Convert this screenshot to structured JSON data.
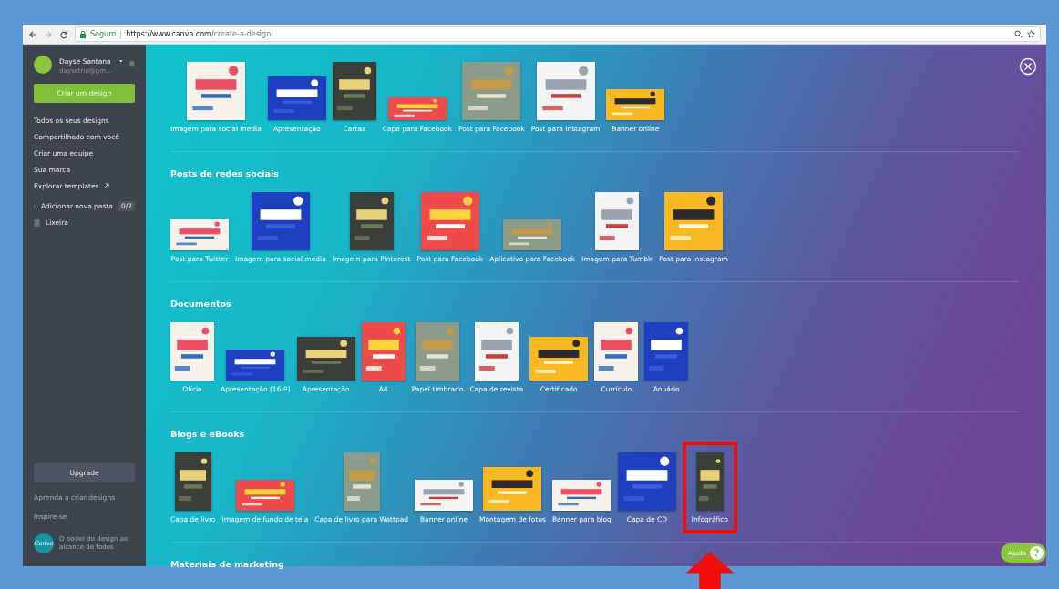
{
  "browser": {
    "security_label": "Seguro",
    "url_host": "https://www.canva.com",
    "url_path": "/create-a-design"
  },
  "sidebar": {
    "user": {
      "name": "Dayse Santana",
      "email": "daysetrin@gm..."
    },
    "create_button": "Criar um design",
    "nav": [
      {
        "label": "Todos os seus designs",
        "external": false
      },
      {
        "label": "Compartilhado com você",
        "external": false
      },
      {
        "label": "Criar uma equipe",
        "external": false
      },
      {
        "label": "Sua marca",
        "external": false
      },
      {
        "label": "Explorar templates",
        "external": true
      }
    ],
    "folder": {
      "label": "Adicionar nova pasta",
      "count": "0/2"
    },
    "trash": "Lixeira",
    "upgrade": "Upgrade",
    "links": [
      "Aprenda a criar designs",
      "Inspire-se"
    ],
    "logo": "Canva",
    "tagline": "O poder do design ao alcance de todos"
  },
  "sections": [
    {
      "items": [
        {
          "label": "Imagem para social media",
          "kind": "square",
          "highlighted": false
        },
        {
          "label": "Apresentação",
          "kind": "landscape",
          "highlighted": false
        },
        {
          "label": "Cartaz",
          "kind": "portrait",
          "highlighted": false
        },
        {
          "label": "Capa para Facebook",
          "kind": "banner",
          "highlighted": false
        },
        {
          "label": "Post para Facebook",
          "kind": "square",
          "highlighted": false
        },
        {
          "label": "Post para Instagram",
          "kind": "square",
          "highlighted": false
        },
        {
          "label": "Banner online",
          "kind": "wide",
          "highlighted": false
        }
      ]
    },
    {
      "title": "Posts de redes sociais",
      "items": [
        {
          "label": "Post para Twitter",
          "kind": "wide",
          "highlighted": false
        },
        {
          "label": "Imagem para social media",
          "kind": "square",
          "highlighted": false
        },
        {
          "label": "Imagem para Pinterest",
          "kind": "portrait",
          "highlighted": false
        },
        {
          "label": "Post para Facebook",
          "kind": "square",
          "highlighted": false
        },
        {
          "label": "Aplicativo para Facebook",
          "kind": "wide",
          "highlighted": false
        },
        {
          "label": "Imagem para Tumblr",
          "kind": "portrait",
          "highlighted": false
        },
        {
          "label": "Post para Instagram",
          "kind": "square",
          "highlighted": false
        }
      ]
    },
    {
      "title": "Documentos",
      "items": [
        {
          "label": "Ofício",
          "kind": "portrait",
          "highlighted": false
        },
        {
          "label": "Apresentação (16:9)",
          "kind": "wide",
          "highlighted": false
        },
        {
          "label": "Apresentação",
          "kind": "landscape",
          "highlighted": false
        },
        {
          "label": "A4",
          "kind": "portrait",
          "highlighted": false
        },
        {
          "label": "Papel timbrado",
          "kind": "portrait",
          "highlighted": false
        },
        {
          "label": "Capa de revista",
          "kind": "portrait",
          "highlighted": false
        },
        {
          "label": "Certificado",
          "kind": "landscape",
          "highlighted": false
        },
        {
          "label": "Currículo",
          "kind": "portrait",
          "highlighted": false
        },
        {
          "label": "Anuário",
          "kind": "portrait",
          "highlighted": false
        }
      ]
    },
    {
      "title": "Blogs e eBooks",
      "items": [
        {
          "label": "Capa de livro",
          "kind": "tall",
          "highlighted": false
        },
        {
          "label": "Imagem de fundo de tela",
          "kind": "wide",
          "highlighted": false
        },
        {
          "label": "Capa de livro para Wattpad",
          "kind": "tall",
          "highlighted": false
        },
        {
          "label": "Banner online",
          "kind": "wide",
          "highlighted": false
        },
        {
          "label": "Montagem de fotos",
          "kind": "landscape",
          "highlighted": false
        },
        {
          "label": "Banner para blog",
          "kind": "wide",
          "highlighted": false
        },
        {
          "label": "Capa de CD",
          "kind": "square",
          "highlighted": false
        },
        {
          "label": "Infográfico",
          "kind": "strip",
          "highlighted": true
        }
      ]
    },
    {
      "title": "Materiais de marketing"
    }
  ],
  "help_button": {
    "label": "Ajuda",
    "icon": "?"
  }
}
